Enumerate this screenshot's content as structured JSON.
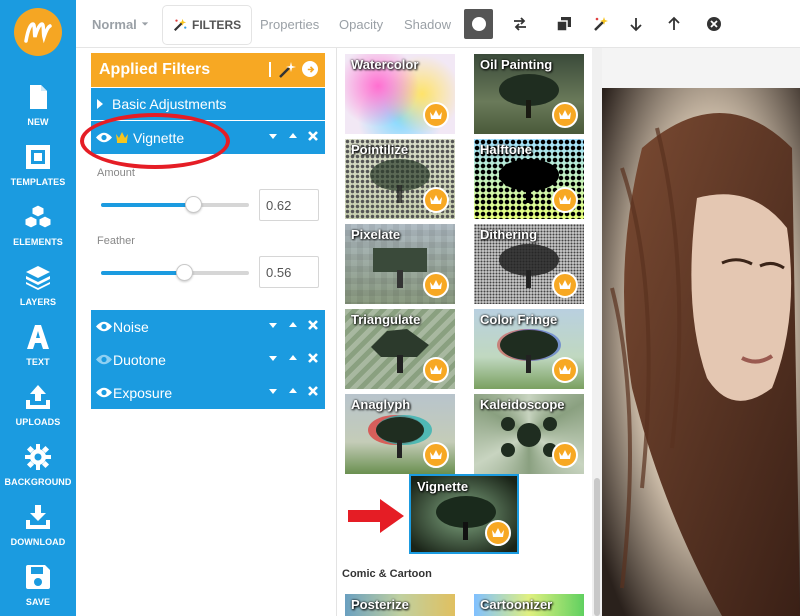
{
  "sidebar": {
    "items": [
      {
        "label": "NEW",
        "icon": "new-file-icon"
      },
      {
        "label": "TEMPLATES",
        "icon": "templates-icon"
      },
      {
        "label": "ELEMENTS",
        "icon": "elements-cubes-icon"
      },
      {
        "label": "LAYERS",
        "icon": "layers-icon"
      },
      {
        "label": "TEXT",
        "icon": "text-letter-a-icon"
      },
      {
        "label": "UPLOADS",
        "icon": "upload-icon"
      },
      {
        "label": "BACKGROUND",
        "icon": "gear-icon"
      },
      {
        "label": "DOWNLOAD",
        "icon": "download-icon"
      },
      {
        "label": "SAVE",
        "icon": "save-floppy-icon"
      }
    ]
  },
  "toolbar": {
    "blend_mode": "Normal",
    "filters": "FILTERS",
    "properties": "Properties",
    "opacity": "Opacity",
    "shadow": "Shadow"
  },
  "panel": {
    "title": "Applied Filters",
    "basic": "Basic Adjustments",
    "vignette": "Vignette",
    "amount_label": "Amount",
    "amount_value": "0.62",
    "amount_fraction": 0.62,
    "feather_label": "Feather",
    "feather_value": "0.56",
    "feather_fraction": 0.56,
    "filters": [
      "Noise",
      "Duotone",
      "Exposure"
    ]
  },
  "grid": {
    "thumbs": [
      "Watercolor",
      "Oil Painting",
      "Pointilize",
      "Halftone",
      "Pixelate",
      "Dithering",
      "Triangulate",
      "Color Fringe",
      "Anaglyph",
      "Kaleidoscope",
      "Vignette"
    ],
    "section": "Comic & Cartoon",
    "thumbs2": [
      "Posterize",
      "Cartoonizer"
    ]
  },
  "colors": {
    "accent_blue": "#1b9be0",
    "accent_orange": "#f7a823",
    "annotation_red": "#e51d25"
  }
}
